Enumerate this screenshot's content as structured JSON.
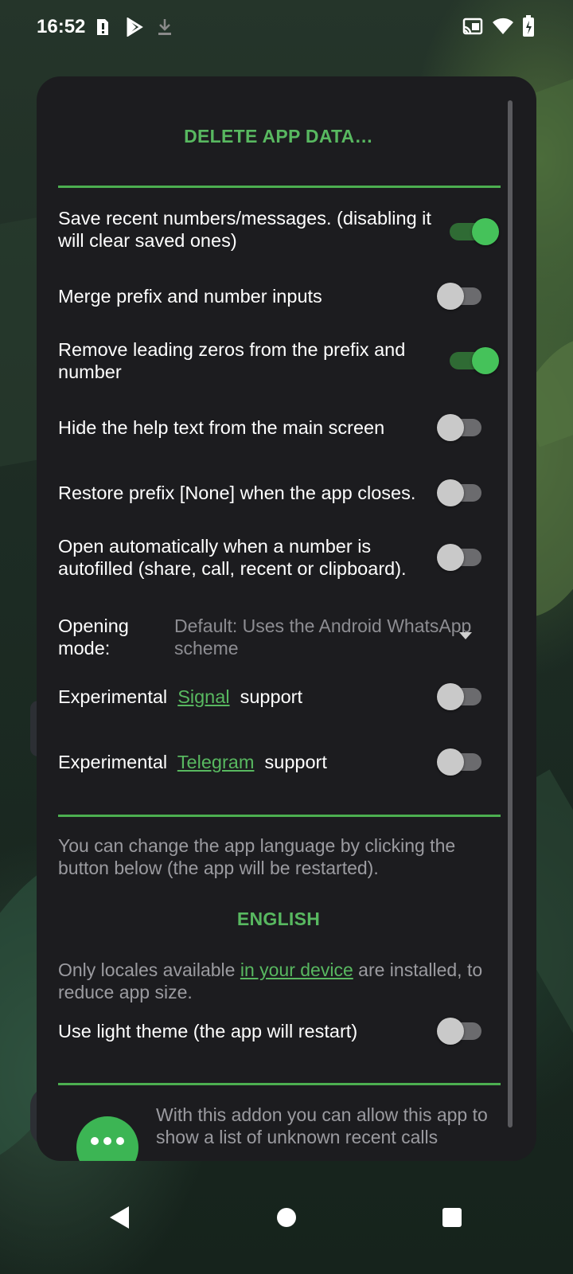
{
  "status_bar": {
    "time": "16:52",
    "left_icons": [
      "alert-icon",
      "play-store-icon",
      "download-icon"
    ],
    "right_icons": [
      "cast-icon",
      "wifi-icon",
      "battery-charging-icon"
    ]
  },
  "dialog": {
    "delete_data_button": "DELETE APP DATA…",
    "settings": [
      {
        "id": "save-recent",
        "label": "Save recent numbers/messages. (disabling it will clear saved ones)",
        "enabled": true
      },
      {
        "id": "merge-prefix",
        "label": "Merge prefix and number inputs",
        "enabled": false
      },
      {
        "id": "remove-zeros",
        "label": "Remove leading zeros from the prefix and number",
        "enabled": true
      },
      {
        "id": "hide-help",
        "label": "Hide the help text from the main screen",
        "enabled": false
      },
      {
        "id": "restore-prefix",
        "label": "Restore prefix [None] when the app closes.",
        "enabled": false
      },
      {
        "id": "open-auto",
        "label": "Open automatically when a number is autofilled (share, call, recent or clipboard).",
        "enabled": false
      }
    ],
    "opening_mode": {
      "label": "Opening mode:",
      "value": "Default: Uses the Android WhatsApp scheme"
    },
    "experimental": [
      {
        "id": "signal",
        "prefix": "Experimental",
        "link": "Signal",
        "suffix": "support",
        "enabled": false
      },
      {
        "id": "telegram",
        "prefix": "Experimental",
        "link": "Telegram",
        "suffix": "support",
        "enabled": false
      }
    ],
    "language_note": "You can change the app language by clicking the button below (the app will be restarted).",
    "language_button": "ENGLISH",
    "locales_note": {
      "before": "Only locales available ",
      "link": "in your device",
      "after": " are installed, to reduce app size."
    },
    "light_theme": {
      "label": "Use light theme (the app will restart)",
      "enabled": false
    },
    "addon_text": "With this addon you can allow this app to show a list of unknown recent calls"
  },
  "colors": {
    "accent": "#58b860",
    "dialog_bg": "#1c1c1f",
    "toggle_on": "#45c25a",
    "toggle_off": "#c9c9c9"
  }
}
